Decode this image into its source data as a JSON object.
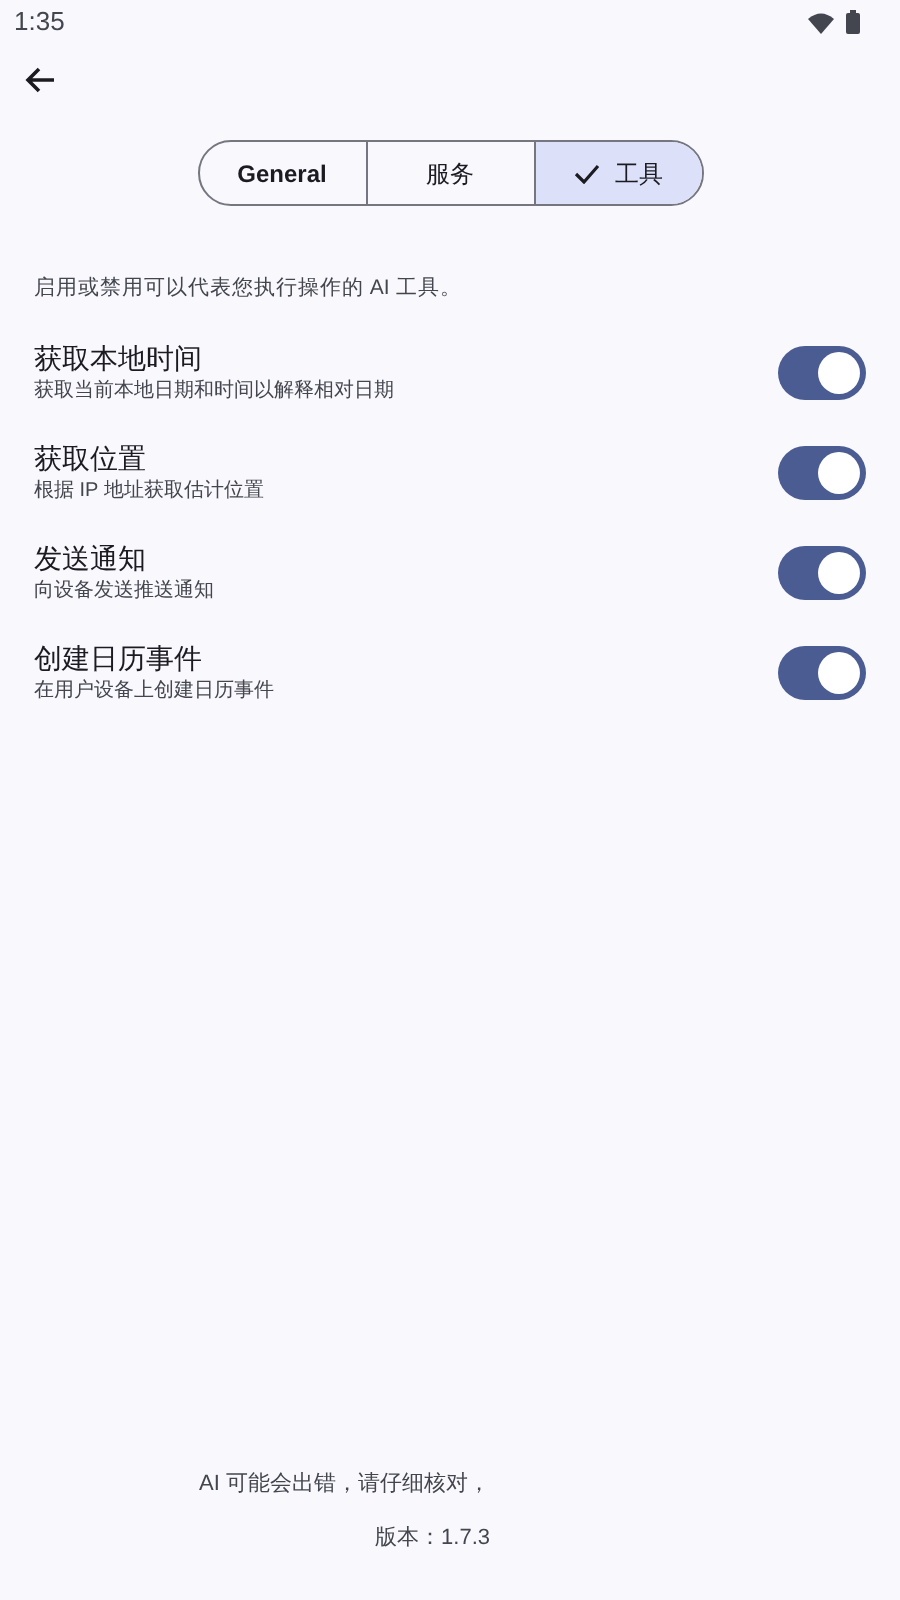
{
  "status_bar": {
    "time": "1:35"
  },
  "tabs": [
    {
      "label": "General",
      "selected": false
    },
    {
      "label": "服务",
      "selected": false
    },
    {
      "label": "工具",
      "selected": true
    }
  ],
  "description": "启用或禁用可以代表您执行操作的 AI 工具。",
  "tools": [
    {
      "title": "获取本地时间",
      "subtitle": "获取当前本地日期和时间以解释相对日期",
      "on": true
    },
    {
      "title": "获取位置",
      "subtitle": "根据 IP 地址获取估计位置",
      "on": true
    },
    {
      "title": "发送通知",
      "subtitle": "向设备发送推送通知",
      "on": true
    },
    {
      "title": "创建日历事件",
      "subtitle": "在用户设备上创建日历事件",
      "on": true
    }
  ],
  "footer": {
    "disclaimer": "AI 可能会出错，请仔细核对，",
    "version": "版本：1.7.3"
  }
}
